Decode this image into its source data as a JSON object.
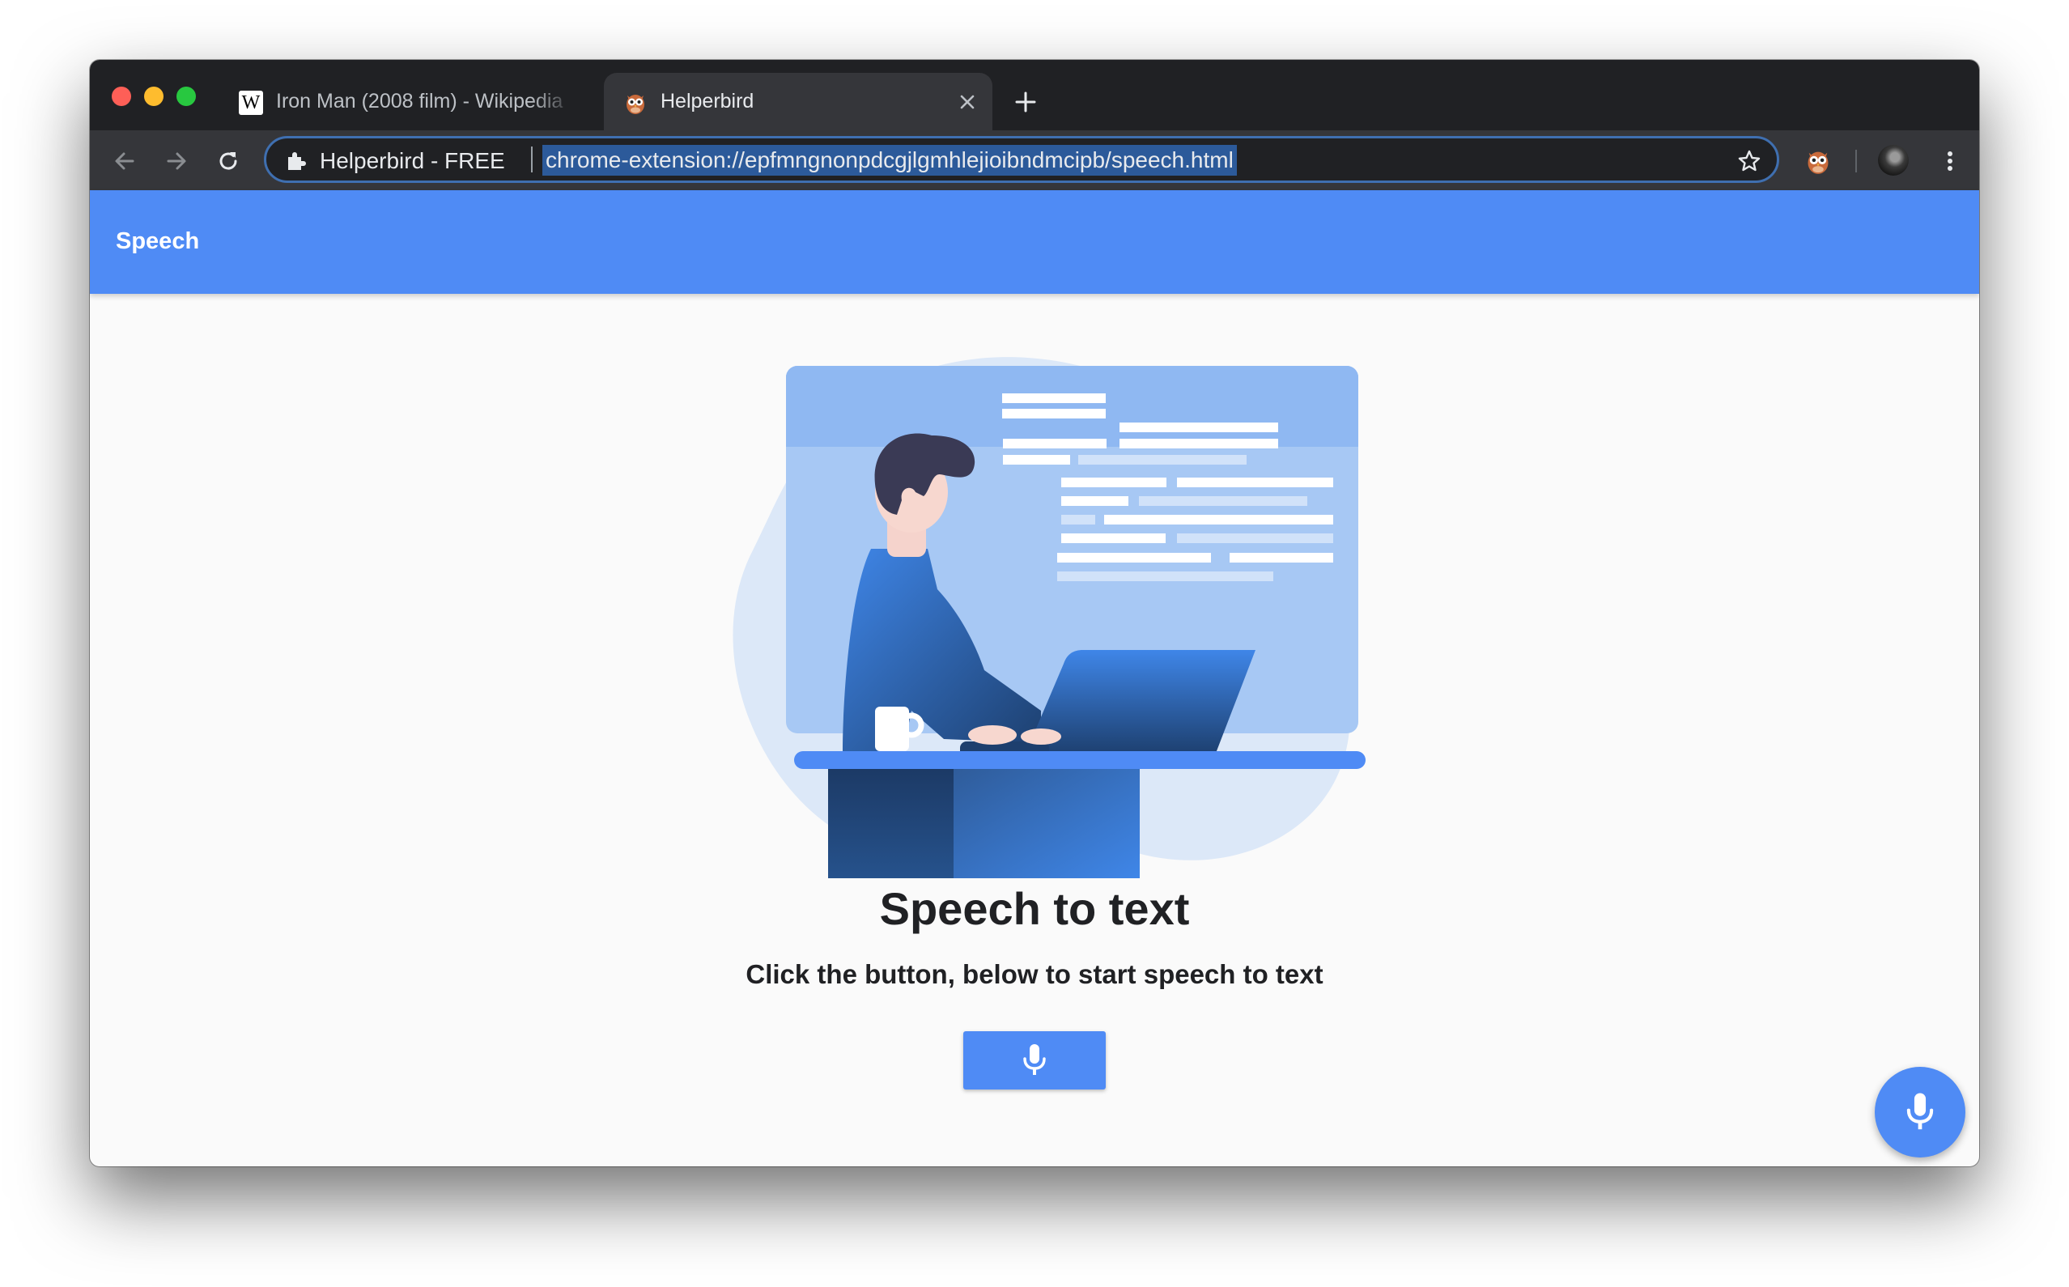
{
  "browser": {
    "tabs": [
      {
        "title": "Iron Man (2008 film) - Wikipedia",
        "favicon": "wikipedia-icon",
        "active": false
      },
      {
        "title": "Helperbird",
        "favicon": "owl-icon",
        "active": true
      }
    ],
    "omnibox": {
      "site_label": "Helperbird - FREE",
      "url": "chrome-extension://epfmngnonpdcgjlgmhlejioibndmcipb/speech.html"
    },
    "icons": {
      "back": "arrow-left-icon",
      "forward": "arrow-right-icon",
      "reload": "reload-icon",
      "extension": "puzzle-icon",
      "bookmark": "star-icon",
      "menu": "vertical-dots-icon"
    }
  },
  "app": {
    "header_title": "Speech",
    "heading": "Speech to text",
    "subheading": "Click the button, below to start speech to text",
    "mic_button_icon": "microphone-icon",
    "fab_icon": "microphone-icon"
  },
  "colors": {
    "accent": "#4f8bf5",
    "background": "#fafafa",
    "chrome_dark": "#202124",
    "chrome_toolbar": "#35363a"
  }
}
